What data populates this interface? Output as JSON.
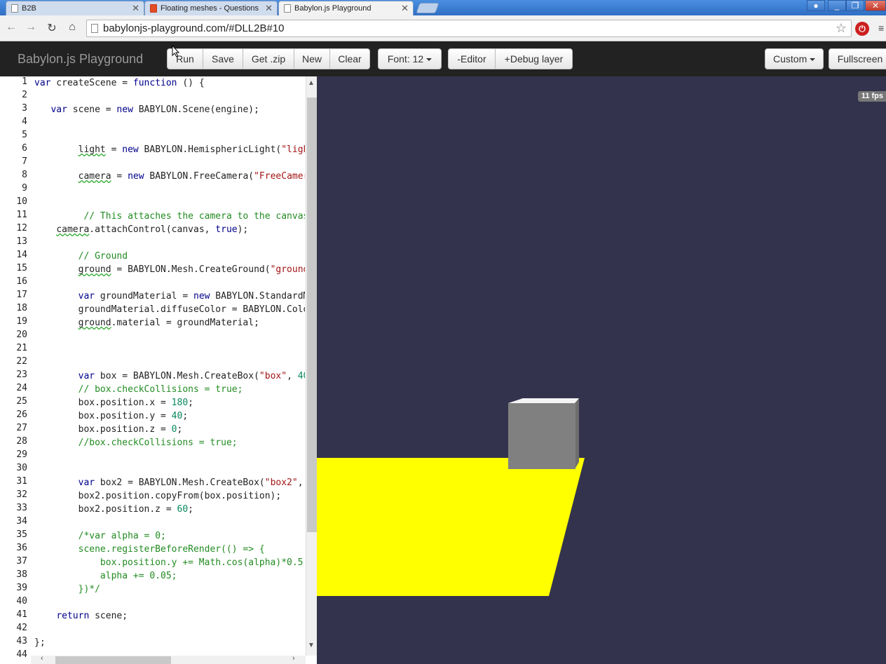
{
  "browser": {
    "tabs": [
      {
        "title": "B2B",
        "favicon": "page-icon",
        "active": false
      },
      {
        "title": "Floating meshes - Questions",
        "favicon": "html5-icon",
        "active": false
      },
      {
        "title": "Babylon.js Playground",
        "favicon": "page-icon",
        "active": true
      }
    ],
    "url": "babylonjs-playground.com/#DLL2B#10",
    "back_icon": "←",
    "forward_icon": "→",
    "reload_icon": "↻",
    "home_icon": "⌂",
    "star_icon": "☆",
    "menu_icon": "≡"
  },
  "navbar": {
    "brand": "Babylon.js Playground",
    "run": "Run",
    "save": "Save",
    "get_zip": "Get .zip",
    "new": "New",
    "clear": "Clear",
    "font": "Font: 12",
    "editor_toggle": "-Editor",
    "debug_layer": "+Debug layer",
    "custom": "Custom",
    "fullscreen": "Fullscreen"
  },
  "editor": {
    "line_numbers": [
      "1",
      "2",
      "3",
      "4",
      "5",
      "6",
      "7",
      "8",
      "9",
      "10",
      "11",
      "12",
      "13",
      "14",
      "15",
      "16",
      "17",
      "18",
      "19",
      "20",
      "21",
      "22",
      "23",
      "24",
      "25",
      "26",
      "27",
      "28",
      "29",
      "30",
      "31",
      "32",
      "33",
      "34",
      "35",
      "36",
      "37",
      "38",
      "39",
      "40",
      "41",
      "42",
      "43",
      "44"
    ]
  },
  "scene": {
    "fps": "11 fps",
    "background_color": "#33334d",
    "ground_color": "#ffff00",
    "box_color": "#808080"
  }
}
